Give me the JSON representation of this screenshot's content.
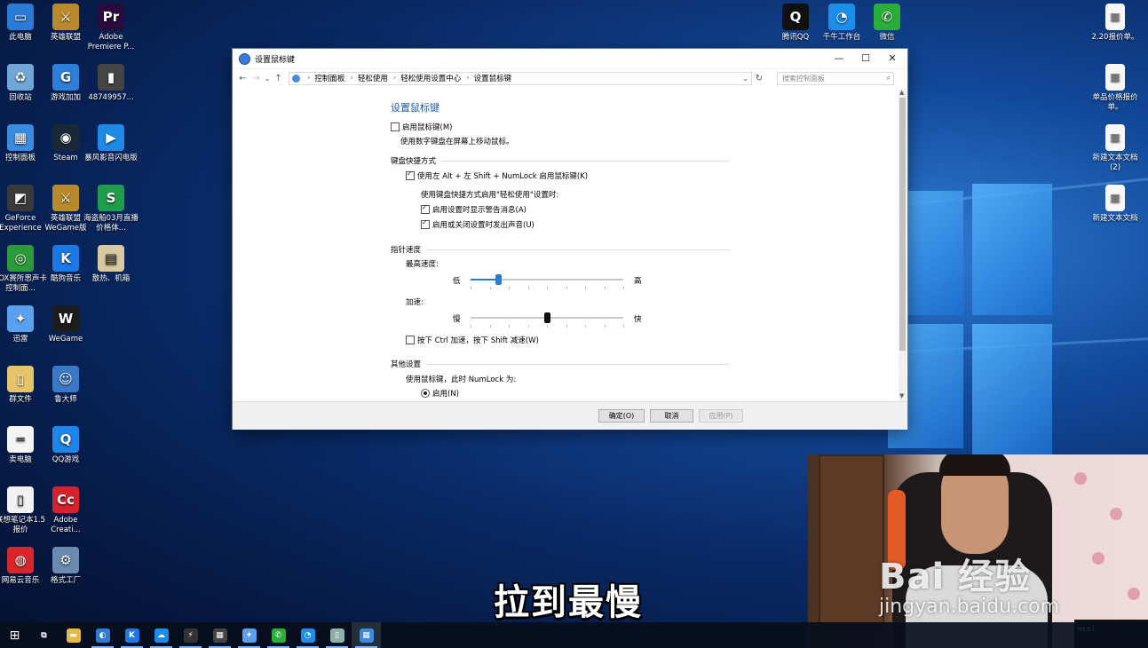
{
  "desktop": {
    "icons": [
      {
        "label": "此电脑",
        "color": "#2b7ad6",
        "glyph": "▭"
      },
      {
        "label": "英雄联盟",
        "color": "#b88a2a",
        "glyph": "⚔"
      },
      {
        "label": "Adobe Premiere P...",
        "color": "#2a0b3d",
        "glyph": "Pr"
      },
      {
        "label": "回收站",
        "color": "#6fa8d8",
        "glyph": "♻"
      },
      {
        "label": "游戏加加",
        "color": "#2e7fd8",
        "glyph": "G"
      },
      {
        "label": "48749957...",
        "color": "#444444",
        "glyph": "▮"
      },
      {
        "label": "控制面板",
        "color": "#3a8ae0",
        "glyph": "▦"
      },
      {
        "label": "Steam",
        "color": "#1b2838",
        "glyph": "◉"
      },
      {
        "label": "暴风影音闪电版",
        "color": "#1d8ae6",
        "glyph": "▶"
      },
      {
        "label": "GeForce Experience",
        "color": "#3a3a3a",
        "glyph": "◩"
      },
      {
        "label": "英雄联盟WeGame版",
        "color": "#b88a2a",
        "glyph": "⚔"
      },
      {
        "label": "海盗船03月直播价格体...",
        "color": "#1f9d4a",
        "glyph": "S"
      },
      {
        "label": "XOX赛所思声卡控制面...",
        "color": "#2a9a3a",
        "glyph": "◎"
      },
      {
        "label": "酷狗音乐",
        "color": "#1b79e6",
        "glyph": "K"
      },
      {
        "label": "散热、机箱",
        "color": "#d9c9a0",
        "glyph": "▤"
      },
      {
        "label": "迅雷",
        "color": "#5aa0ee",
        "glyph": "✦"
      },
      {
        "label": "WeGame",
        "color": "#1d1d1d",
        "glyph": "W"
      },
      {
        "label": "群文件",
        "color": "#e6c46a",
        "glyph": "▯"
      },
      {
        "label": "鲁大师",
        "color": "#3a78c8",
        "glyph": "☺"
      },
      {
        "label": "卖电脑",
        "color": "#f4f4f4",
        "glyph": "═"
      },
      {
        "label": "QQ游戏",
        "color": "#1d86e8",
        "glyph": "Q"
      },
      {
        "label": "联想笔记本1.5报价",
        "color": "#f2f2f2",
        "glyph": "▯"
      },
      {
        "label": "Adobe Creati...",
        "color": "#d4232e",
        "glyph": "Cc"
      },
      {
        "label": "网易云音乐",
        "color": "#d9262c",
        "glyph": "◍"
      },
      {
        "label": "格式工厂",
        "color": "#6a8ab0",
        "glyph": "⚙"
      }
    ],
    "right_icons": [
      {
        "label": "腾讯QQ",
        "color": "#111111",
        "glyph": "Q"
      },
      {
        "label": "千牛工作台",
        "color": "#1a8ee8",
        "glyph": "◔"
      },
      {
        "label": "微信",
        "color": "#2aae3a",
        "glyph": "✆"
      }
    ],
    "files": [
      {
        "label": "2.20报价单。"
      },
      {
        "label": "单品价格报价单。"
      },
      {
        "label": "新建文本文档(2)"
      },
      {
        "label": "新建文本文档"
      }
    ]
  },
  "window": {
    "title": "设置鼠标键",
    "controls": {
      "minimize": "—",
      "maximize": "☐",
      "close": "✕"
    },
    "nav": {
      "back": "←",
      "forward": "→",
      "history": "⌄",
      "up": "↑",
      "refresh": "↻"
    },
    "breadcrumb": [
      "控制面板",
      "轻松使用",
      "轻松使用设置中心",
      "设置鼠标键"
    ],
    "breadcrumb_sep": "›",
    "dropdown": "⌄",
    "search_placeholder": "搜索控制面板",
    "search_glyph": "⌕",
    "heading": "设置鼠标键",
    "enable_mouse_keys": {
      "label": "启用鼠标键(M)",
      "checked": false
    },
    "enable_desc": "使用数字键盘在屏幕上移动鼠标。",
    "keyboard_shortcut": {
      "group_label": "键盘快捷方式",
      "shortcut": {
        "label": "使用左 Alt + 左 Shift + NumLock 启用鼠标键(K)",
        "checked": true
      },
      "sub_intro": "使用键盘快捷方式启用\"轻松使用\"设置时:",
      "warn": {
        "label": "启用设置时显示警告消息(A)",
        "checked": true
      },
      "sound": {
        "label": "启用或关闭设置时发出声音(U)",
        "checked": true
      }
    },
    "pointer_speed": {
      "group_label": "指针速度",
      "top_speed_label": "最高速度:",
      "top_low": "低",
      "top_high": "高",
      "top_speed_value": 0.18,
      "accel_label": "加速:",
      "accel_low": "慢",
      "accel_high": "快",
      "accel_value": 0.5,
      "ctrl_shift": {
        "label": "按下 Ctrl 加速，按下 Shift 减速(W)",
        "checked": false
      }
    },
    "other": {
      "group_label": "其他设置",
      "numlock_intro": "使用鼠标键，此时 NumLock 为:",
      "on": {
        "label": "启用(N)",
        "selected": true
      }
    },
    "scroll": {
      "up": "▲",
      "down": "▼"
    },
    "buttons": {
      "ok": "确定(O)",
      "cancel": "取消",
      "apply": "应用(P)"
    }
  },
  "taskbar": {
    "start": "⊞",
    "items": [
      {
        "name": "task-view",
        "glyph": "⧉",
        "color": "transparent"
      },
      {
        "name": "file-explorer",
        "glyph": "▬",
        "color": "#e6b845"
      },
      {
        "name": "browser",
        "glyph": "◐",
        "color": "#2b7ad6"
      },
      {
        "name": "kugou",
        "glyph": "K",
        "color": "#1b79e6"
      },
      {
        "name": "baidu-disk",
        "glyph": "☁",
        "color": "#1f8be8"
      },
      {
        "name": "cmd",
        "glyph": "⚡",
        "color": "#333333"
      },
      {
        "name": "calculator",
        "glyph": "▦",
        "color": "#444444"
      },
      {
        "name": "xunlei",
        "glyph": "✦",
        "color": "#5aa0ee"
      },
      {
        "name": "wechat",
        "glyph": "✆",
        "color": "#2aae3a"
      },
      {
        "name": "qianniu",
        "glyph": "◔",
        "color": "#1a8ee8"
      },
      {
        "name": "notepad",
        "glyph": "▯",
        "color": "#8ab0a8"
      },
      {
        "name": "control-panel",
        "glyph": "▦",
        "color": "#3a8ae0"
      }
    ]
  },
  "overlay": {
    "subtitle": "拉到最慢",
    "watermark_main": "Bai 经验",
    "watermark_url": "jingyan.baidu.com",
    "cam_brand": "msi"
  },
  "colors": {
    "accent": "#2a7ad8",
    "heading": "#1e5aa8"
  }
}
